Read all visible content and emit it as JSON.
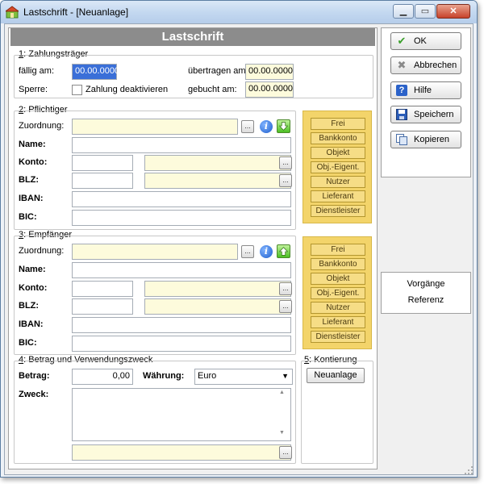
{
  "window": {
    "title": "Lastschrift - [Neuanlage]",
    "min_glyph": "▁",
    "max_glyph": "▭",
    "close_glyph": "✕"
  },
  "header": {
    "title": "Lastschrift"
  },
  "zahlungstraeger": {
    "num": "1",
    "title": ": Zahlungsträger",
    "faellig_label": "fällig am:",
    "faellig_value": "00.00.0000",
    "uebertragen_label": "übertragen am:",
    "uebertragen_value": "00.00.0000",
    "sperre_label": "Sperre:",
    "zahlung_deaktivieren_label": "Zahlung deaktivieren",
    "gebucht_label": "gebucht am:",
    "gebucht_value": "00.00.0000"
  },
  "pflichtiger": {
    "num": "2",
    "title": ": Pflichtiger",
    "zuordnung_label": "Zuordnung:",
    "zuordnung_value": "",
    "name_label": "Name:",
    "name_value": "",
    "konto_label": "Konto:",
    "konto_value": "",
    "konto_bank_value": "",
    "blz_label": "BLZ:",
    "blz_value": "",
    "blz_bank_value": "",
    "iban_label": "IBAN:",
    "iban_value": "",
    "bic_label": "BIC:",
    "bic_value": ""
  },
  "empfaenger": {
    "num": "3",
    "title": ": Empfänger",
    "zuordnung_label": "Zuordnung:",
    "zuordnung_value": "",
    "name_label": "Name:",
    "name_value": "",
    "konto_label": "Konto:",
    "konto_value": "",
    "konto_bank_value": "",
    "blz_label": "BLZ:",
    "blz_value": "",
    "blz_bank_value": "",
    "iban_label": "IBAN:",
    "iban_value": "",
    "bic_label": "BIC:",
    "bic_value": ""
  },
  "zuordnung_types": {
    "frei": "Frei",
    "bankkonto": "Bankkonto",
    "objekt": "Objekt",
    "obj_eigent": "Obj.-Eigent.",
    "nutzer": "Nutzer",
    "lieferant": "Lieferant",
    "dienstleister": "Dienstleister"
  },
  "betrag": {
    "num": "4",
    "title": ": Betrag und Verwendungszweck",
    "betrag_label": "Betrag:",
    "betrag_value": "0,00",
    "waehrung_label": "Währung:",
    "waehrung_value": "Euro",
    "zweck_label": "Zweck:",
    "zweck_value": "",
    "zweck_extra_value": ""
  },
  "kontierung": {
    "num": "5",
    "title": ": Kontierung",
    "neuanlage_label": "Neuanlage"
  },
  "actions": {
    "ok": "OK",
    "abbrechen": "Abbrechen",
    "hilfe": "Hilfe",
    "speichern": "Speichern",
    "kopieren": "Kopieren"
  },
  "side_links": {
    "vorgaenge": "Vorgänge",
    "referenz": "Referenz"
  },
  "glyphs": {
    "dots": "...",
    "info": "i",
    "dropdown": "▼",
    "scroll_up": "▲",
    "scroll_down": "▼"
  },
  "colors": {
    "header_bar": "#8c8c8c",
    "yellow_panel": "#f3d46a",
    "input_yellow": "#fdfbdc",
    "selection_blue": "#3a6fd8"
  }
}
